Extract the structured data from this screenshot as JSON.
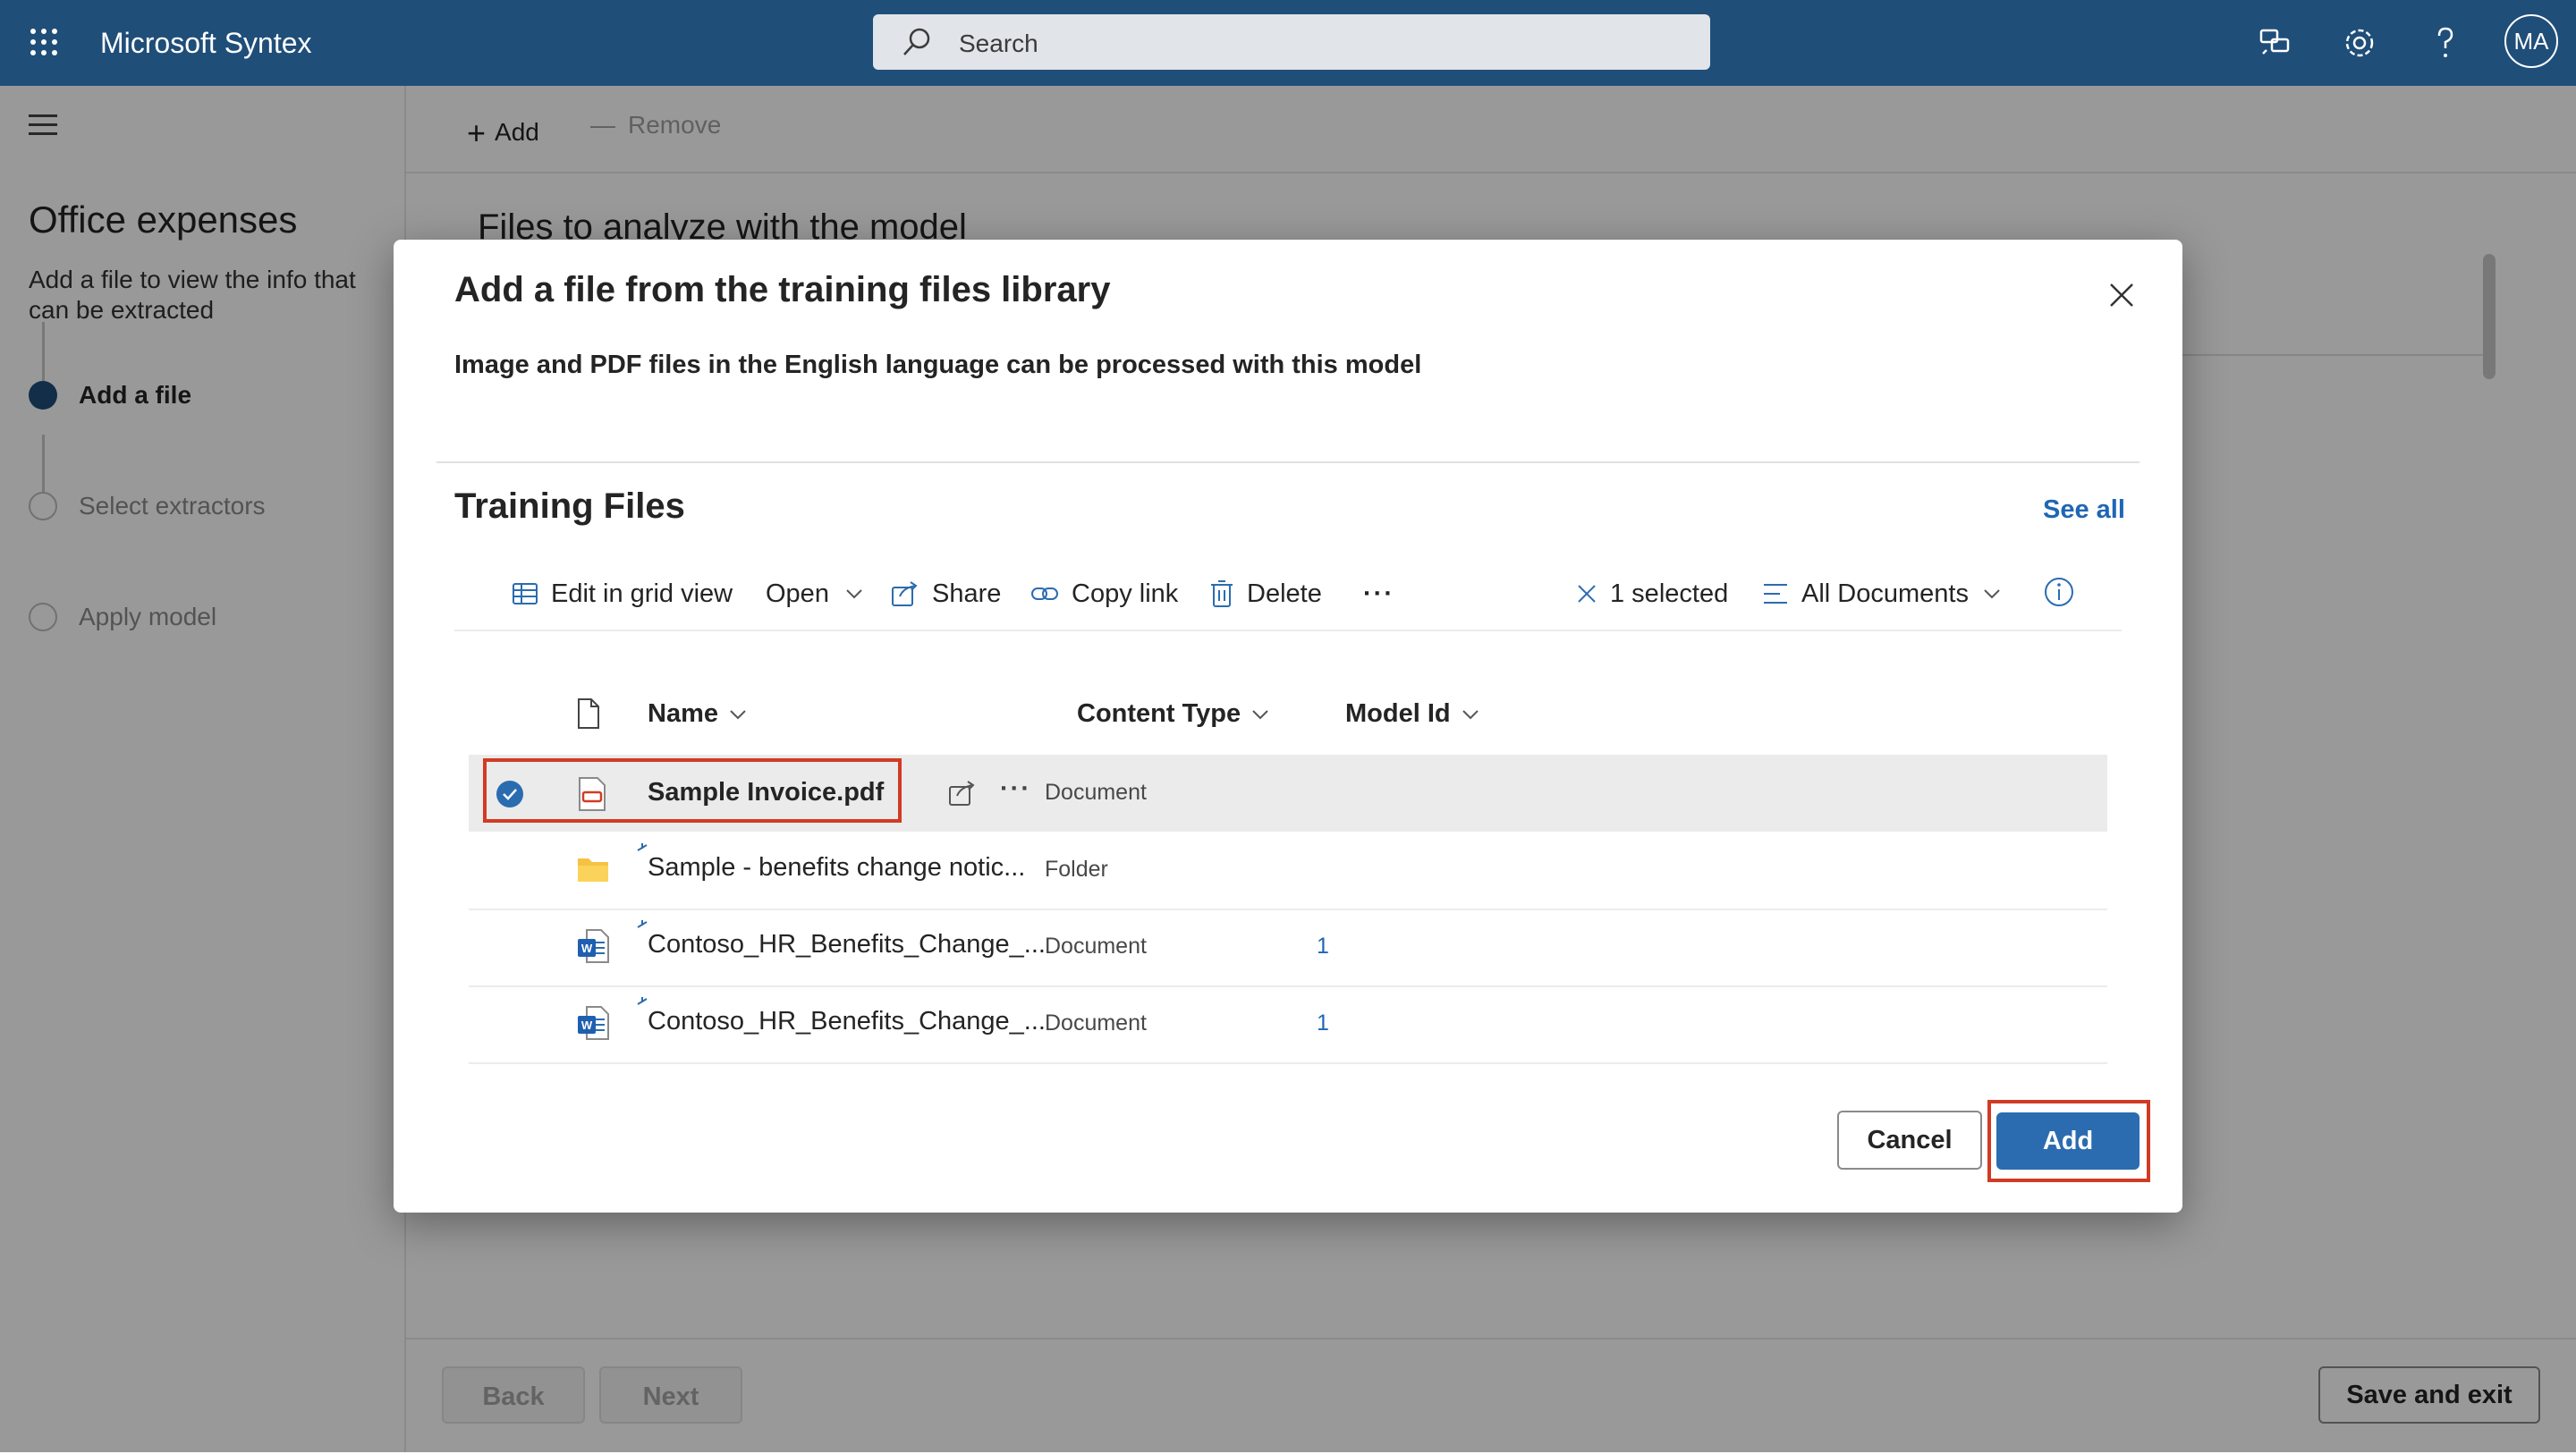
{
  "topbar": {
    "app_title": "Microsoft Syntex",
    "search_placeholder": "Search",
    "avatar_initials": "MA",
    "icons": [
      "app-launcher-icon",
      "feedback-icon",
      "settings-icon",
      "help-icon"
    ]
  },
  "left_panel": {
    "title": "Office expenses",
    "description": "Add a file to view the info that can be extracted",
    "steps": [
      {
        "label": "Add a file",
        "state": "active"
      },
      {
        "label": "Select extractors",
        "state": "inactive"
      },
      {
        "label": "Apply model",
        "state": "inactive"
      }
    ]
  },
  "main": {
    "command_add": "Add",
    "command_remove": "Remove",
    "heading": "Files to analyze with the model",
    "footer_back": "Back",
    "footer_next": "Next",
    "footer_save": "Save and exit"
  },
  "dialog": {
    "title": "Add a file from the training files library",
    "subtitle": "Image and PDF files in the English language can be processed with this model",
    "library_title": "Training Files",
    "see_all": "See all",
    "toolbar": {
      "edit_grid": "Edit in grid view",
      "open": "Open",
      "share": "Share",
      "copy_link": "Copy link",
      "delete": "Delete",
      "selected": "1 selected",
      "view": "All Documents"
    },
    "columns": {
      "name": "Name",
      "content_type": "Content Type",
      "model_id": "Model Id"
    },
    "rows": [
      {
        "name": "Sample Invoice.pdf",
        "content_type": "Document",
        "model_id": "",
        "icon": "pdf-file-icon",
        "selected": true
      },
      {
        "name": "Sample - benefits change notic...",
        "content_type": "Folder",
        "model_id": "",
        "icon": "folder-icon",
        "selected": false
      },
      {
        "name": "Contoso_HR_Benefits_Change_...",
        "content_type": "Document",
        "model_id": "1",
        "icon": "word-file-icon",
        "selected": false
      },
      {
        "name": "Contoso_HR_Benefits_Change_...",
        "content_type": "Document",
        "model_id": "1",
        "icon": "word-file-icon",
        "selected": false
      }
    ],
    "cancel_label": "Cancel",
    "add_label": "Add"
  },
  "colors": {
    "topbar": "#1f4e79",
    "accent": "#2b6cb0",
    "highlight": "#d13b24",
    "link": "#1f66b5"
  }
}
